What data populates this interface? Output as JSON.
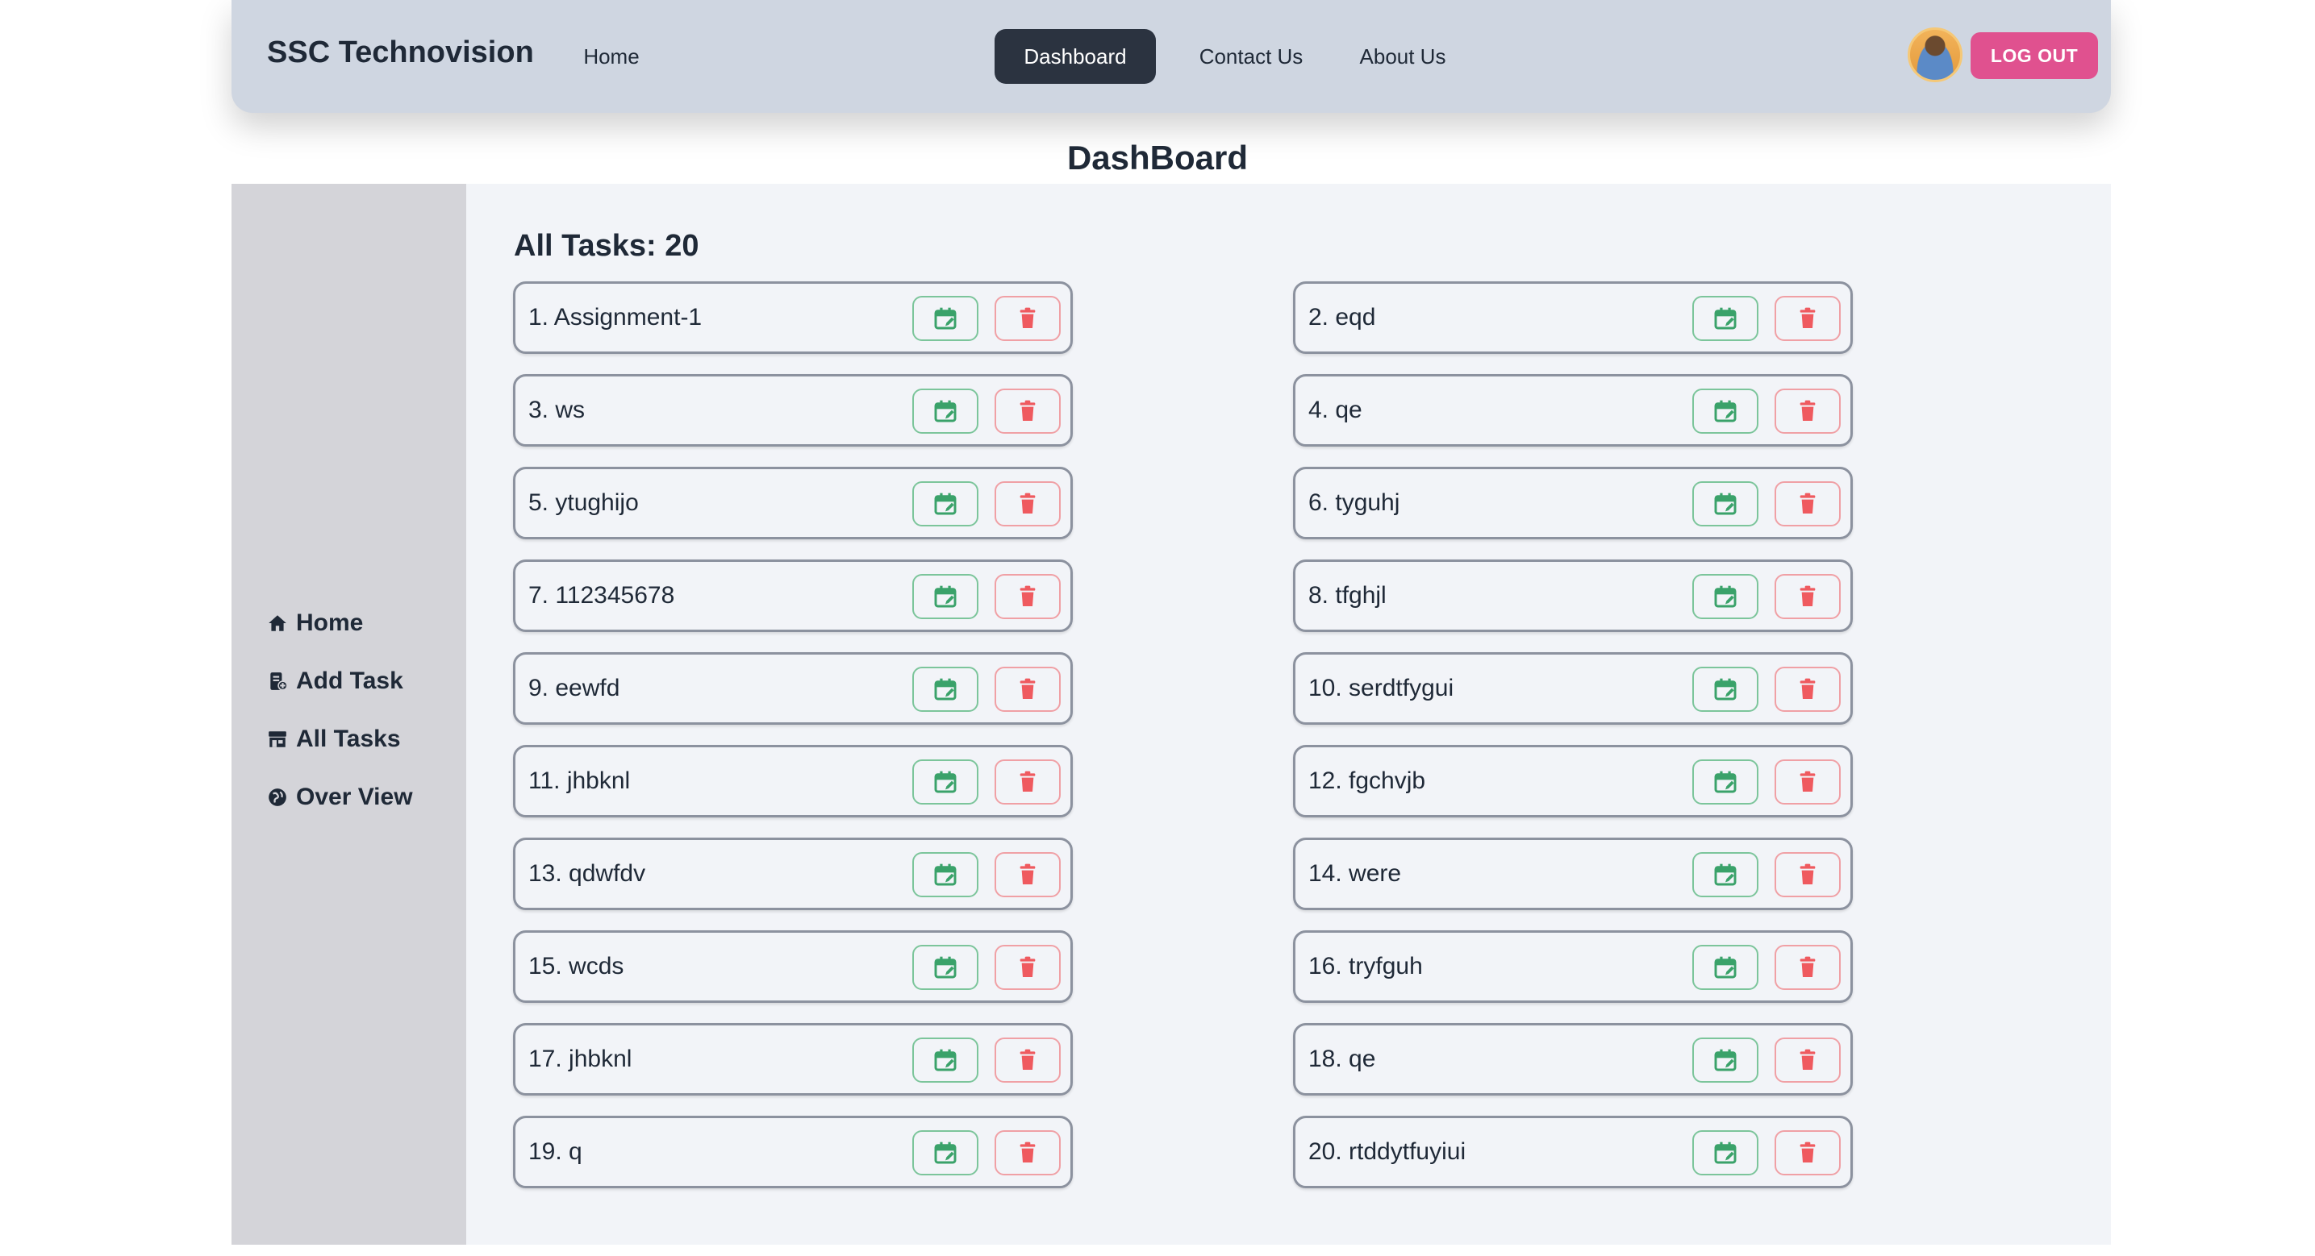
{
  "brand": "SSC Technovision",
  "nav": {
    "home": "Home",
    "dashboard": "Dashboard",
    "contact": "Contact Us",
    "about": "About Us",
    "logout": "LOG OUT",
    "active": "Dashboard"
  },
  "page_title": "DashBoard",
  "sidebar": {
    "items": [
      {
        "label": "Home",
        "icon": "house-icon"
      },
      {
        "label": "Add Task",
        "icon": "add-task-icon"
      },
      {
        "label": "All Tasks",
        "icon": "store-icon"
      },
      {
        "label": "Over View",
        "icon": "globe-icon"
      }
    ]
  },
  "main": {
    "heading": "All Tasks: 20",
    "tasks": [
      "1. Assignment-1",
      "2. eqd",
      "3. ws",
      "4. qe",
      "5. ytughijo",
      "6. tyguhj",
      "7. 112345678",
      "8. tfghjl",
      "9. eewfd",
      "10. serdtfygui",
      "11. jhbknl",
      "12. fgchvjb",
      "13. qdwfdv",
      "14. were",
      "15. wcds",
      "16. tryfguh",
      "17. jhbknl",
      "18. qe",
      "19. q",
      "20. rtddytfuyiui"
    ],
    "task_actions": {
      "edit_icon": "calendar-edit-icon",
      "delete_icon": "trash-icon"
    }
  },
  "colors": {
    "navbar_bg": "#cfd6e1",
    "active_nav_bg": "#2b3340",
    "logout_bg": "#e0518f",
    "sidebar_bg": "#d4d4d9",
    "main_bg": "#f2f4f8",
    "edit_accent": "#3aa26a",
    "delete_accent": "#ef5a5f"
  }
}
